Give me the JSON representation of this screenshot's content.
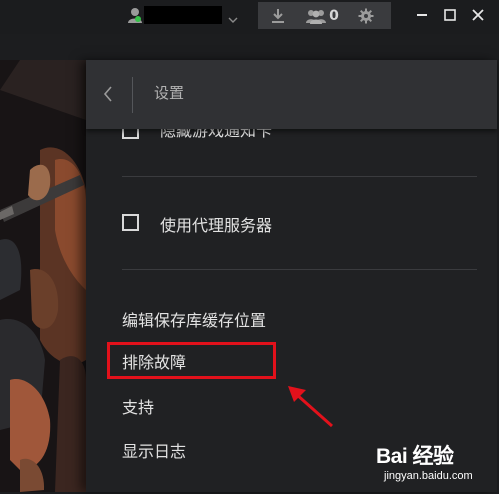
{
  "titlebar": {
    "user_name": "",
    "friend_count": "0"
  },
  "settings": {
    "title": "设置",
    "items": [
      {
        "label": "隐藏游戏通知卡",
        "type": "checkbox",
        "checked": false
      },
      {
        "label": "使用代理服务器",
        "type": "checkbox",
        "checked": false
      },
      {
        "label": "编辑保存库缓存位置",
        "type": "link"
      },
      {
        "label": "排除故障",
        "type": "link",
        "highlighted": true
      },
      {
        "label": "支持",
        "type": "link"
      },
      {
        "label": "显示日志",
        "type": "link"
      }
    ]
  },
  "annotation": {
    "highlight_color": "#e2111b"
  },
  "watermark": {
    "brand": "Bai 经验",
    "url": "jingyan.baidu.com"
  },
  "colors": {
    "titlebar_bg": "#1b1c1e",
    "panel_bg": "#202123",
    "header_bg": "#303134",
    "text": "#e2e2e2",
    "online": "#36c24a"
  }
}
